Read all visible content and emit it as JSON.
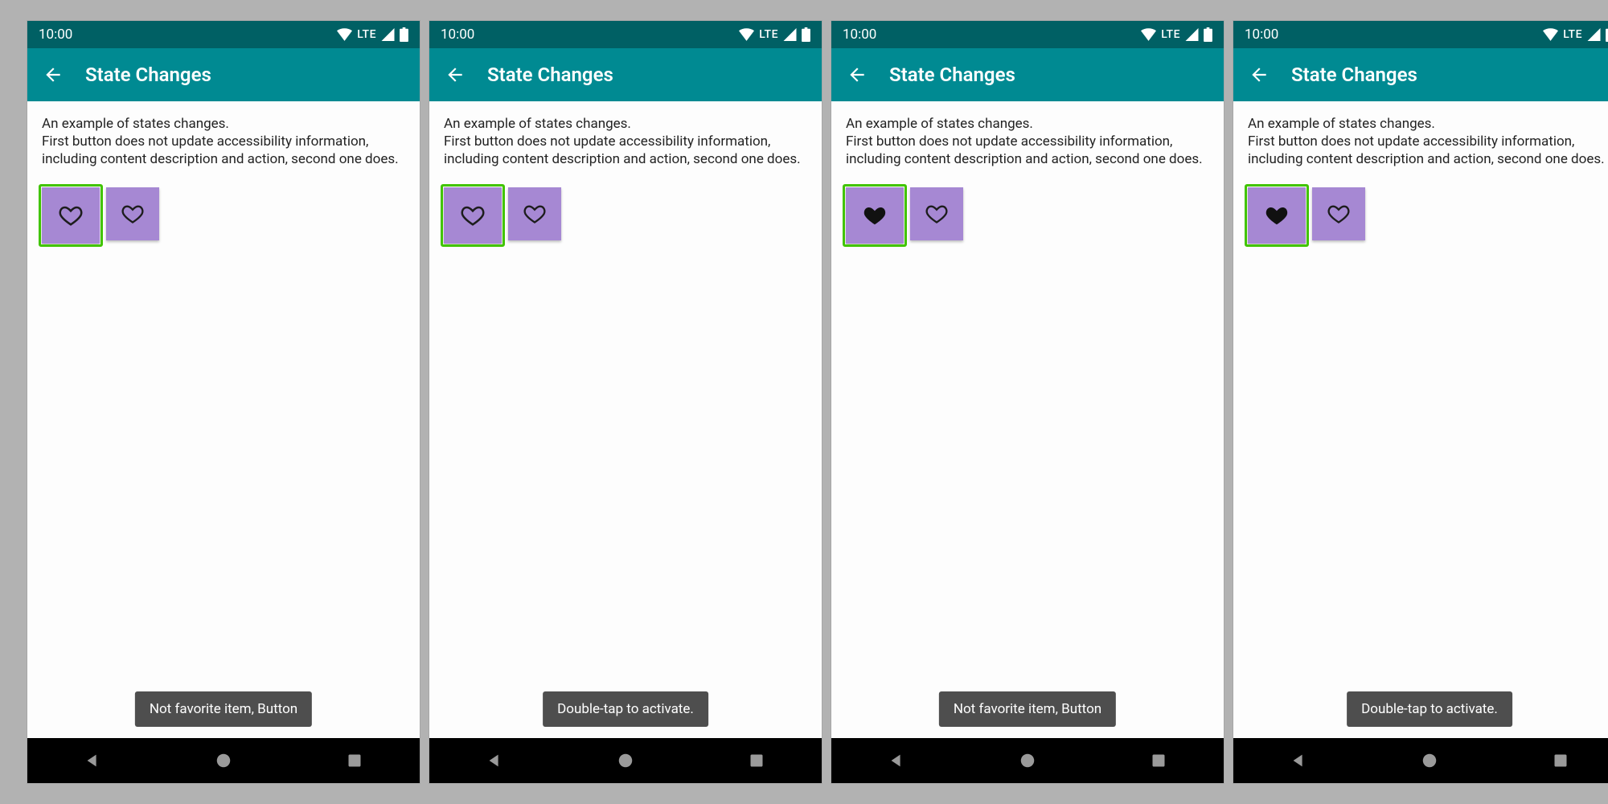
{
  "status": {
    "time": "10:00",
    "network_label": "LTE"
  },
  "appbar": {
    "title": "State Changes"
  },
  "body": {
    "line1": "An example of states changes.",
    "line2": "First button does not update accessibility information, including content description and action, second one does."
  },
  "screens": [
    {
      "button1_filled": false,
      "toast": "Not favorite item, Button"
    },
    {
      "button1_filled": false,
      "toast": "Double-tap to activate."
    },
    {
      "button1_filled": true,
      "toast": "Not favorite item, Button"
    },
    {
      "button1_filled": true,
      "toast": "Double-tap to activate."
    }
  ],
  "colors": {
    "status_bg": "#006064",
    "appbar_bg": "#008a92",
    "button_bg": "#a688d3",
    "focus_ring": "#41c400",
    "toast_bg": "#4e4e4e"
  }
}
